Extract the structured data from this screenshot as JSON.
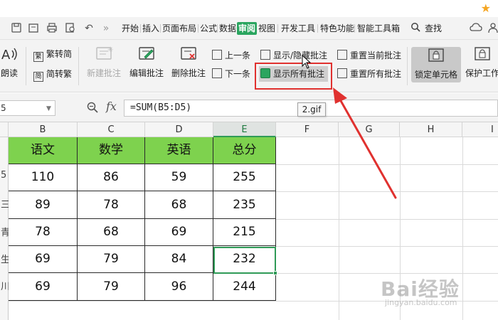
{
  "topbar": {
    "star_icon": "star-icon"
  },
  "menubar": {
    "items": [
      "开始",
      "插入",
      "页面布局",
      "公式",
      "数据",
      "审阅",
      "视图",
      "开发工具",
      "特色功能",
      "智能工具箱"
    ],
    "active": "审阅",
    "search_label": "查找",
    "active_color": "#2aa55f"
  },
  "ribbon": {
    "read_aloud": "朗读",
    "trad_to_simp": "繁转简",
    "simp_to_trad": "简转繁",
    "new_comment": "新建批注",
    "edit_comment": "编辑批注",
    "delete_comment": "删除批注",
    "prev": "上一条",
    "next": "下一条",
    "show_hide_comment": "显示/隐藏批注",
    "show_all_comments": "显示所有批注",
    "reset_current_comment": "重置当前批注",
    "reset_all_comments": "重置所有批注",
    "lock_cell": "锁定单元格",
    "protect_sheet": "保护工作"
  },
  "formula_bar": {
    "name_box": "5",
    "fx": "fx",
    "formula": "=SUM(B5:D5)"
  },
  "tooltip": "2.gif",
  "columns": [
    "B",
    "C",
    "D",
    "E",
    "F",
    "G",
    "H",
    "I"
  ],
  "selected_column": "E",
  "row_headers_partial": [
    "",
    "5",
    "三",
    "青",
    "生",
    "川"
  ],
  "table": {
    "header": [
      "语文",
      "数学",
      "英语",
      "总分"
    ],
    "rows": [
      [
        "110",
        "86",
        "59",
        "255"
      ],
      [
        "89",
        "78",
        "68",
        "235"
      ],
      [
        "78",
        "68",
        "69",
        "215"
      ],
      [
        "69",
        "79",
        "84",
        "232"
      ],
      [
        "69",
        "79",
        "96",
        "244"
      ]
    ],
    "header_color": "#7ed24e",
    "selected_cell_color": "#2f9a57"
  },
  "annotation": {
    "arrow_color": "#e0312f"
  },
  "watermark": {
    "brand": "Bai经验",
    "url": "jingyan.baidu.com"
  }
}
